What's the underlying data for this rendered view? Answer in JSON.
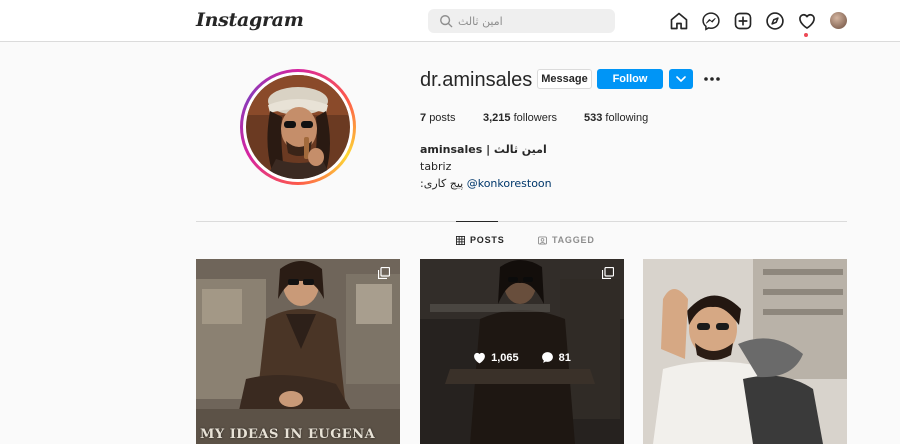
{
  "nav": {
    "logo": "Instagram",
    "search_placeholder": "امین ثالث"
  },
  "profile": {
    "username": "dr.aminsales",
    "message_label": "Message",
    "follow_label": "Follow",
    "posts_count": "7",
    "posts_label": "posts",
    "followers_count": "3,215",
    "followers_label": "followers",
    "following_count": "533",
    "following_label": "following",
    "full_name": "aminsales | امین ثالث",
    "bio_line1": "tabriz",
    "bio_line2_prefix": ":پیج کاری",
    "bio_mention": "@konkorestoon"
  },
  "tabs": [
    {
      "label": "POSTS",
      "icon": "grid-icon",
      "active": true
    },
    {
      "label": "TAGGED",
      "icon": "tag-icon",
      "active": false
    }
  ],
  "posts": [
    {
      "type": "carousel",
      "caption_overlay": "MY IDEAS IN EUGENA"
    },
    {
      "type": "carousel",
      "likes": "1,065",
      "comments": "81",
      "hovered": true
    },
    {
      "type": "image"
    }
  ],
  "colors": {
    "accent": "#0095f6",
    "link": "#00376b",
    "notification_dot": "#ed4956"
  }
}
